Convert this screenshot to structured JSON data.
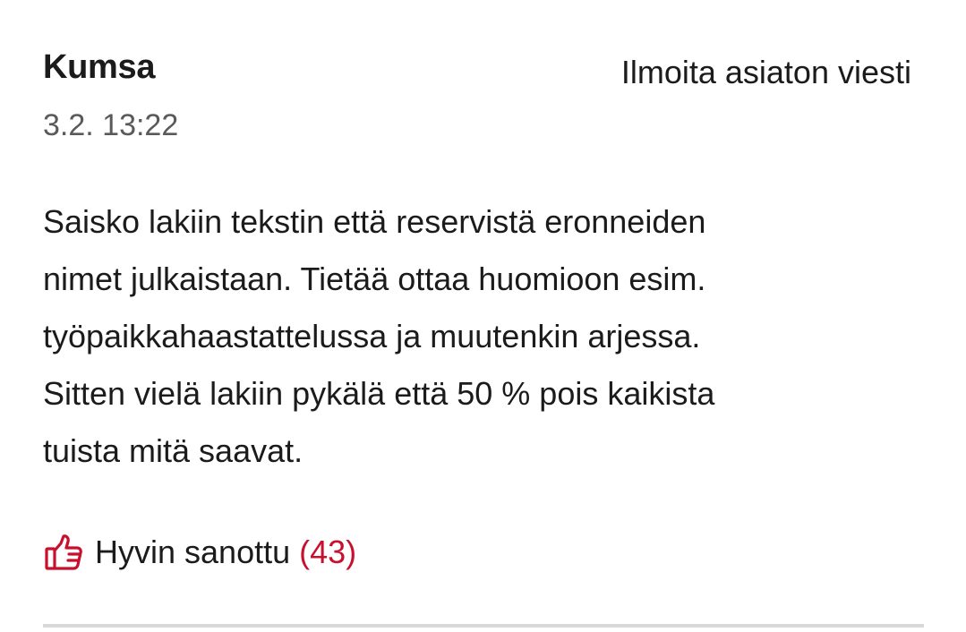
{
  "comment": {
    "author": "Kumsa",
    "timestamp": "3.2. 13:22",
    "report_label": "Ilmoita asiaton viesti",
    "body_lines": [
      "Saisko lakiin tekstin että reservistä eronneiden",
      "nimet julkaistaan. Tietää ottaa huomioon esim.",
      "työpaikkahaastattelussa ja muutenkin arjessa.",
      "Sitten vielä lakiin pykälä että 50 % pois kaikista",
      "tuista mitä saavat."
    ],
    "like": {
      "icon": "thumbs-up-icon",
      "label": "Hyvin sanottu",
      "count": "(43)"
    }
  },
  "colors": {
    "accent": "#c8102e",
    "text": "#1b1b1b",
    "muted": "#5a5a5a",
    "divider": "#d9d9d9"
  }
}
